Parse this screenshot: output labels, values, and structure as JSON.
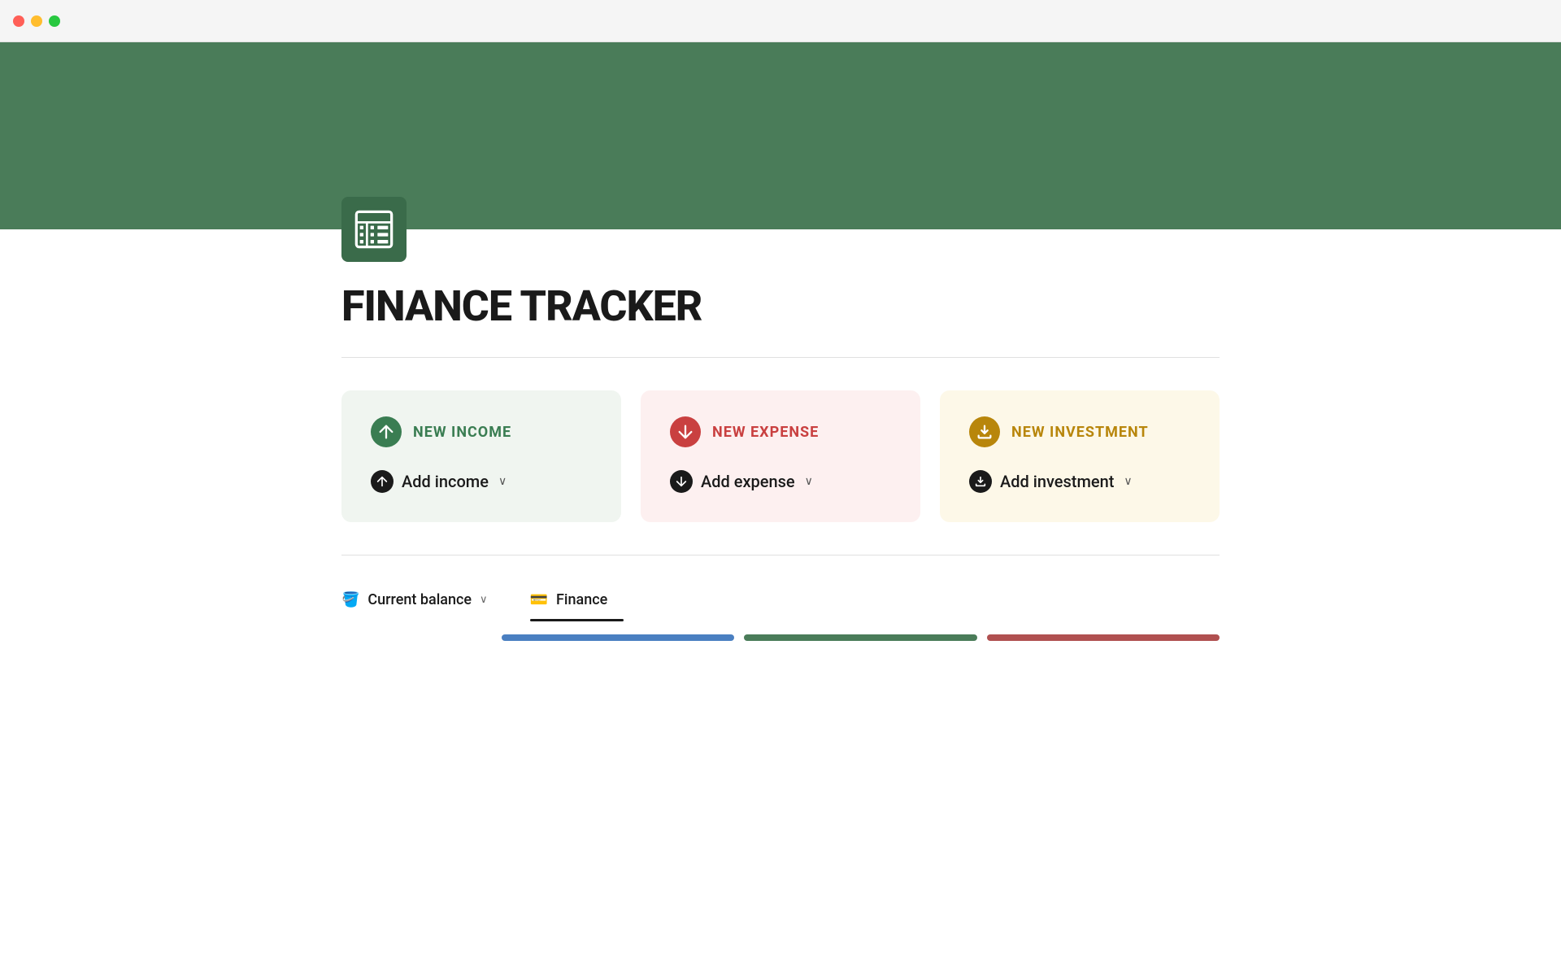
{
  "titlebar": {
    "btn_close": "close",
    "btn_minimize": "minimize",
    "btn_maximize": "maximize"
  },
  "page": {
    "title": "FINANCE TRACKER",
    "icon_label": "spreadsheet-icon"
  },
  "cards": {
    "income": {
      "title": "NEW INCOME",
      "action_label": "Add income",
      "color": "#3a7d52"
    },
    "expense": {
      "title": "NEW EXPENSE",
      "action_label": "Add expense",
      "color": "#c94040"
    },
    "investment": {
      "title": "NEW INVESTMENT",
      "action_label": "Add investment",
      "color": "#b8860b"
    }
  },
  "tabs": {
    "current_balance": {
      "label": "Current balance",
      "icon": "🪣"
    },
    "finance": {
      "label": "Finance",
      "icon": "💳"
    }
  }
}
